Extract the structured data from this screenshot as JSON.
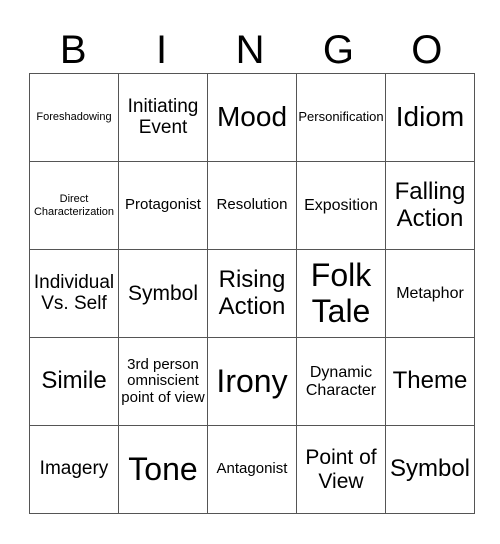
{
  "header": [
    "B",
    "I",
    "N",
    "G",
    "O"
  ],
  "rows": [
    [
      "Foreshadowing",
      "Initiating Event",
      "Mood",
      "Personification",
      "Idiom"
    ],
    [
      "Direct Characterization",
      "Protagonist",
      "Resolution",
      "Exposition",
      "Falling Action"
    ],
    [
      "Individual Vs. Self",
      "Symbol",
      "Rising Action",
      "Folk Tale",
      "Metaphor"
    ],
    [
      "Simile",
      "3rd person omniscient point of view",
      "Irony",
      "Dynamic Character",
      "Theme"
    ],
    [
      "Imagery",
      "Tone",
      "Antagonist",
      "Point of View",
      "Symbol"
    ]
  ]
}
